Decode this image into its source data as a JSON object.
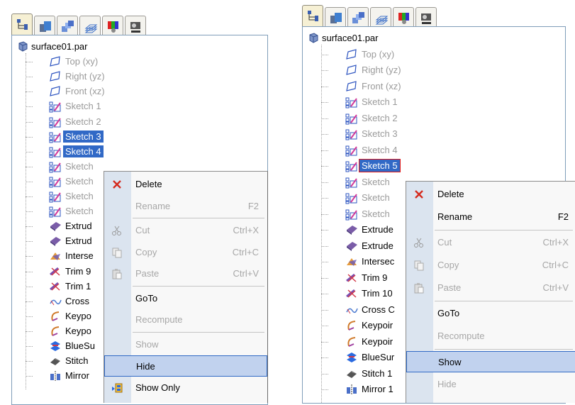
{
  "left": {
    "tabs": [
      "feature-tree-icon",
      "part-library-icon",
      "assembly-icon",
      "layers-icon",
      "color-icon",
      "camera-icon"
    ],
    "root": "surface01.par",
    "items": [
      {
        "label": "Top (xy)",
        "type": "plane",
        "state": "gray"
      },
      {
        "label": "Right (yz)",
        "type": "plane",
        "state": "gray"
      },
      {
        "label": "Front (xz)",
        "type": "plane",
        "state": "gray"
      },
      {
        "label": "Sketch 1",
        "type": "sketch",
        "state": "gray"
      },
      {
        "label": "Sketch 2",
        "type": "sketch",
        "state": "gray"
      },
      {
        "label": "Sketch 3",
        "type": "sketch",
        "state": "selected"
      },
      {
        "label": "Sketch 4",
        "type": "sketch",
        "state": "selected"
      },
      {
        "label": "Sketch",
        "type": "sketch",
        "state": "gray"
      },
      {
        "label": "Sketch",
        "type": "sketch",
        "state": "gray"
      },
      {
        "label": "Sketch",
        "type": "sketch",
        "state": "gray"
      },
      {
        "label": "Sketch",
        "type": "sketch",
        "state": "gray"
      },
      {
        "label": "Extrud",
        "type": "extrude",
        "state": "normal"
      },
      {
        "label": "Extrud",
        "type": "extrude",
        "state": "normal"
      },
      {
        "label": "Interse",
        "type": "intersect",
        "state": "normal"
      },
      {
        "label": "Trim 9",
        "type": "trim",
        "state": "normal"
      },
      {
        "label": "Trim 1",
        "type": "trim",
        "state": "normal"
      },
      {
        "label": "Cross",
        "type": "cross",
        "state": "normal"
      },
      {
        "label": "Keypo",
        "type": "keypoint",
        "state": "normal"
      },
      {
        "label": "Keypo",
        "type": "keypoint",
        "state": "normal"
      },
      {
        "label": "BlueSu",
        "type": "bluesurf",
        "state": "normal"
      },
      {
        "label": "Stitch",
        "type": "stitch",
        "state": "normal"
      },
      {
        "label": "Mirror",
        "type": "mirror",
        "state": "normal"
      }
    ],
    "menu": [
      {
        "label": "Delete",
        "key": "",
        "state": "normal",
        "icon": "delete-icon"
      },
      {
        "label": "Rename",
        "key": "F2",
        "state": "disabled",
        "icon": ""
      },
      {
        "label": "Cut",
        "key": "Ctrl+X",
        "state": "disabled",
        "icon": "cut-icon"
      },
      {
        "label": "Copy",
        "key": "Ctrl+C",
        "state": "disabled",
        "icon": "copy-icon"
      },
      {
        "label": "Paste",
        "key": "Ctrl+V",
        "state": "disabled",
        "icon": "paste-icon"
      },
      {
        "label": "GoTo",
        "key": "",
        "state": "normal",
        "icon": ""
      },
      {
        "label": "Recompute",
        "key": "",
        "state": "disabled",
        "icon": ""
      },
      {
        "label": "Show",
        "key": "",
        "state": "disabled",
        "icon": ""
      },
      {
        "label": "Hide",
        "key": "",
        "state": "highlighted",
        "icon": ""
      },
      {
        "label": "Show Only",
        "key": "",
        "state": "normal",
        "icon": "show-only-icon"
      }
    ]
  },
  "right": {
    "root": "surface01.par",
    "items": [
      {
        "label": "Top (xy)",
        "type": "plane",
        "state": "gray"
      },
      {
        "label": "Right (yz)",
        "type": "plane",
        "state": "gray"
      },
      {
        "label": "Front (xz)",
        "type": "plane",
        "state": "gray"
      },
      {
        "label": "Sketch 1",
        "type": "sketch",
        "state": "gray"
      },
      {
        "label": "Sketch 2",
        "type": "sketch",
        "state": "gray"
      },
      {
        "label": "Sketch 3",
        "type": "sketch",
        "state": "gray"
      },
      {
        "label": "Sketch 4",
        "type": "sketch",
        "state": "gray"
      },
      {
        "label": "Sketch 5",
        "type": "sketch",
        "state": "selected-outline"
      },
      {
        "label": "Sketch",
        "type": "sketch",
        "state": "gray"
      },
      {
        "label": "Sketch",
        "type": "sketch",
        "state": "gray"
      },
      {
        "label": "Sketch",
        "type": "sketch",
        "state": "gray"
      },
      {
        "label": "Extrude",
        "type": "extrude",
        "state": "normal"
      },
      {
        "label": "Extrude",
        "type": "extrude",
        "state": "normal"
      },
      {
        "label": "Intersec",
        "type": "intersect",
        "state": "normal"
      },
      {
        "label": "Trim 9",
        "type": "trim",
        "state": "normal"
      },
      {
        "label": "Trim 10",
        "type": "trim",
        "state": "normal"
      },
      {
        "label": "Cross C",
        "type": "cross",
        "state": "normal"
      },
      {
        "label": "Keypoir",
        "type": "keypoint",
        "state": "normal"
      },
      {
        "label": "Keypoir",
        "type": "keypoint",
        "state": "normal"
      },
      {
        "label": "BlueSur",
        "type": "bluesurf",
        "state": "normal"
      },
      {
        "label": "Stitch 1",
        "type": "stitch",
        "state": "normal"
      },
      {
        "label": "Mirror 1",
        "type": "mirror",
        "state": "normal"
      }
    ],
    "menu": [
      {
        "label": "Delete",
        "key": "",
        "state": "normal",
        "icon": "delete-icon"
      },
      {
        "label": "Rename",
        "key": "F2",
        "state": "normal",
        "icon": ""
      },
      {
        "label": "Cut",
        "key": "Ctrl+X",
        "state": "disabled",
        "icon": "cut-icon"
      },
      {
        "label": "Copy",
        "key": "Ctrl+C",
        "state": "disabled",
        "icon": "copy-icon"
      },
      {
        "label": "Paste",
        "key": "Ctrl+V",
        "state": "disabled",
        "icon": "paste-icon"
      },
      {
        "label": "GoTo",
        "key": "",
        "state": "normal",
        "icon": ""
      },
      {
        "label": "Recompute",
        "key": "",
        "state": "disabled",
        "icon": ""
      },
      {
        "label": "Show",
        "key": "",
        "state": "highlighted",
        "icon": ""
      },
      {
        "label": "Hide",
        "key": "",
        "state": "disabled",
        "icon": ""
      }
    ]
  },
  "colors": {
    "selection": "#3169c6",
    "menu_highlight": "#c1d2ee",
    "menu_strip": "#dbe4ef",
    "disabled_text": "#a7a7a7"
  }
}
